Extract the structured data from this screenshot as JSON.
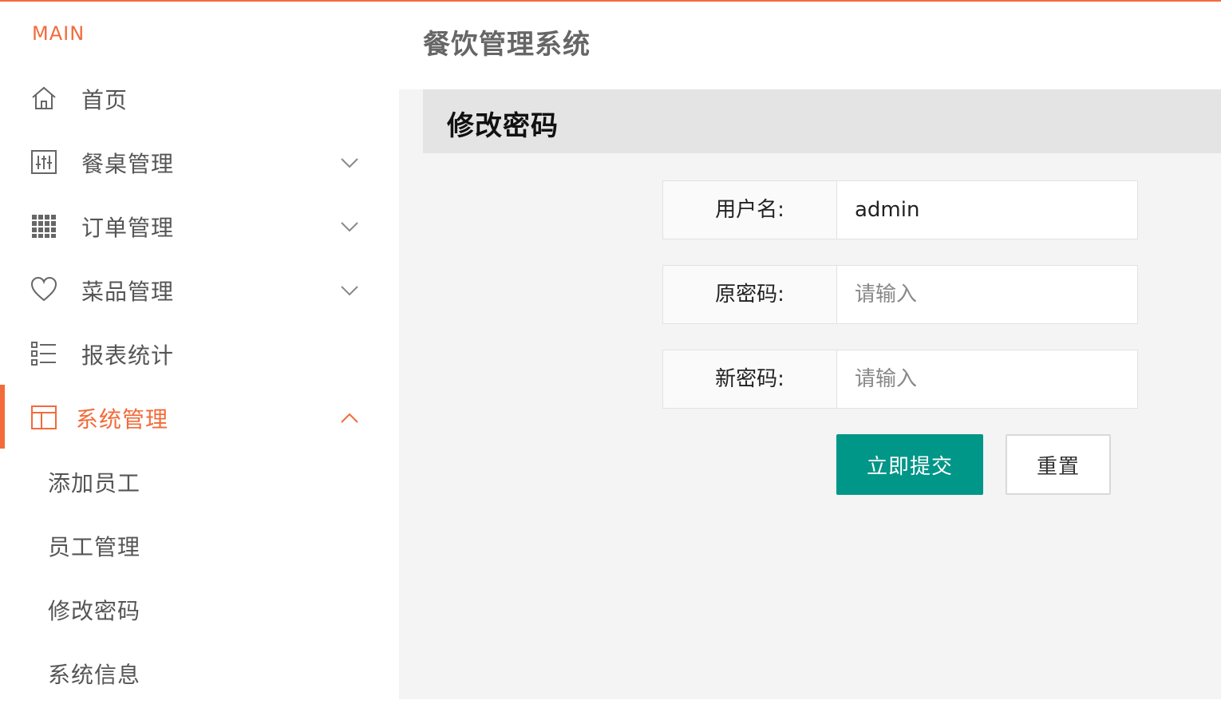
{
  "brand": "MAIN",
  "app_title": "餐饮管理系统",
  "accent_color": "#f26b3a",
  "primary_button_color": "#009688",
  "sidebar": {
    "items": [
      {
        "label": "首页",
        "icon": "home-icon",
        "expandable": false
      },
      {
        "label": "餐桌管理",
        "icon": "sliders-icon",
        "expandable": true,
        "expanded": false
      },
      {
        "label": "订单管理",
        "icon": "grid-icon",
        "expandable": true,
        "expanded": false
      },
      {
        "label": "菜品管理",
        "icon": "heart-icon",
        "expandable": true,
        "expanded": false
      },
      {
        "label": "报表统计",
        "icon": "list-icon",
        "expandable": false
      },
      {
        "label": "系统管理",
        "icon": "layout-icon",
        "expandable": true,
        "expanded": true,
        "active": true
      }
    ],
    "sub_items": [
      {
        "label": "添加员工"
      },
      {
        "label": "员工管理"
      },
      {
        "label": "修改密码"
      },
      {
        "label": "系统信息"
      }
    ]
  },
  "main": {
    "card_title": "修改密码",
    "form": {
      "username_label": "用户名:",
      "username_value": "admin",
      "old_password_label": "原密码:",
      "old_password_placeholder": "请输入",
      "new_password_label": "新密码:",
      "new_password_placeholder": "请输入",
      "submit_label": "立即提交",
      "reset_label": "重置"
    }
  }
}
